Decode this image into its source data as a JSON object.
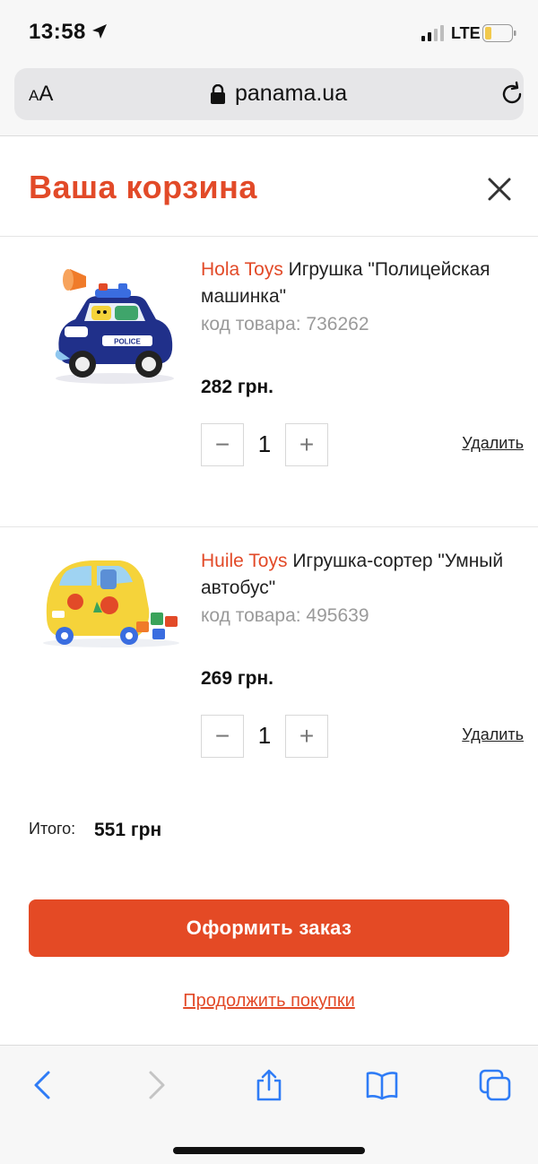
{
  "status_bar": {
    "time": "13:58",
    "network": "LTE"
  },
  "browser": {
    "text_size_label_small": "A",
    "text_size_label_large": "A",
    "url": "panama.ua"
  },
  "cart": {
    "title": "Ваша корзина",
    "items": [
      {
        "brand": "Hola Toys",
        "name": " Игрушка \"Полицейская машинка\"",
        "sku": "код товара: 736262",
        "price": "282 грн.",
        "quantity": "1",
        "minus_label": "−",
        "plus_label": "+",
        "remove_label": "Удалить"
      },
      {
        "brand": "Huile Toys",
        "name": " Игрушка-сортер \"Умный автобус\"",
        "sku": "код товара: 495639",
        "price": "269 грн.",
        "quantity": "1",
        "minus_label": "−",
        "plus_label": "+",
        "remove_label": "Удалить"
      }
    ],
    "total_label": "Итого:",
    "total_value": "551 грн",
    "checkout_label": "Оформить заказ",
    "continue_label": "Продолжить покупки"
  },
  "colors": {
    "accent": "#e24a28",
    "checkout_button": "#e44a25",
    "ios_blue": "#2f7cf6"
  }
}
